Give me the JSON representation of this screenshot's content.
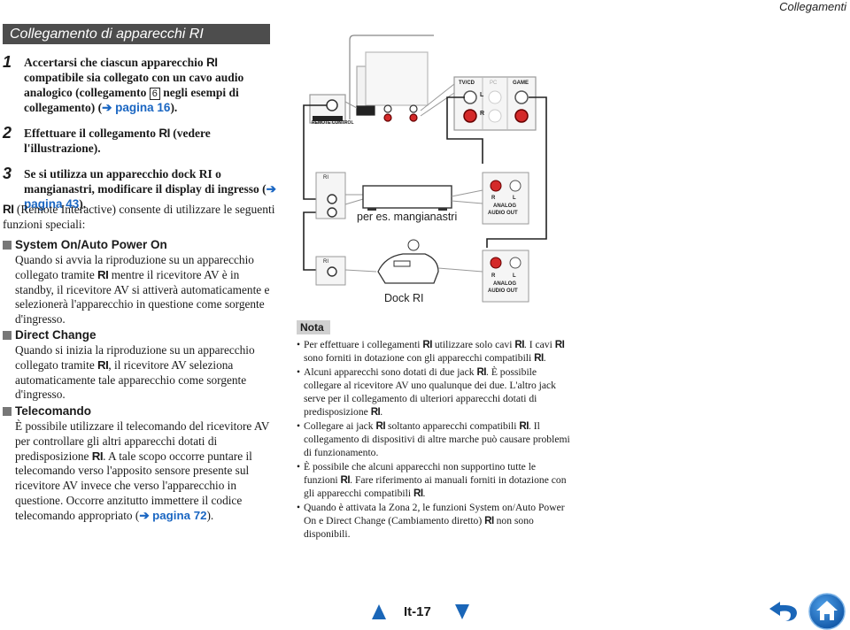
{
  "header": {
    "chapter": "Collegamenti"
  },
  "section": {
    "title": "Collegamento di apparecchi RI"
  },
  "ri_logo": "RI",
  "steps": [
    {
      "num": "1",
      "text_a": "Accertarsi che ciascun apparecchio",
      "text_b": "compatibile sia collegato con un cavo audio analogico (collegamento",
      "box": "6",
      "text_c": "negli esempi di collegamento) (",
      "link": "➔ pagina 16",
      "text_d": ")."
    },
    {
      "num": "2",
      "text_a": "Effettuare il collegamento",
      "text_b": "(vedere l'illustrazione)."
    },
    {
      "num": "3",
      "text_a": "Se si utilizza un apparecchio dock RI o mangianastri, modificare il display di ingresso (",
      "link": "➔ pagina 43",
      "text_d": ")."
    }
  ],
  "intro": {
    "text": "(Remote Interactive) consente di utilizzare le seguenti funzioni speciali:"
  },
  "features": [
    {
      "title": "System On/Auto Power On",
      "body_a": "Quando si avvia la riproduzione su un apparecchio collegato tramite",
      "body_b": "mentre il ricevitore AV è in standby, il ricevitore AV si attiverà automaticamente e selezionerà l'apparecchio in questione come sorgente d'ingresso."
    },
    {
      "title": "Direct Change",
      "body_a": "Quando si inizia la riproduzione su un apparecchio collegato tramite",
      "body_b": ", il ricevitore AV seleziona automaticamente tale apparecchio come sorgente d'ingresso."
    },
    {
      "title": "Telecomando",
      "body_a": "È possibile utilizzare il telecomando del ricevitore AV per controllare gli altri apparecchi dotati di predisposizione",
      "body_b": ". A tale scopo occorre puntare il telecomando verso l'apposito sensore presente sul ricevitore AV invece che verso l'apparecchio in questione. Occorre anzitutto immettere il codice telecomando appropriato (",
      "link": "➔ pagina 72",
      "body_c": ")."
    }
  ],
  "diagram": {
    "remote_control_label": "REMOTE CONTROL",
    "jack_labels": {
      "tvcd": "TV/CD",
      "pc": "PC",
      "game": "GAME",
      "l": "L",
      "r": "R"
    },
    "analog_out": {
      "r": "R",
      "l": "L",
      "line1": "ANALOG",
      "line2": "AUDIO OUT"
    },
    "device1_label": "per es. mangianastri",
    "device2_label": "Dock RI",
    "colors": {
      "red_jack": "#d42a2a",
      "cable": "#222222",
      "panel": "#888888"
    }
  },
  "nota": {
    "label": "Nota",
    "items": [
      {
        "a": "Per effettuare i collegamenti",
        "b": "utilizzare solo cavi",
        "c": ". I cavi",
        "d": "sono forniti in dotazione con gli apparecchi compatibili",
        "e": "."
      },
      {
        "a": "Alcuni apparecchi sono dotati di due jack",
        "b": ". È possibile collegare al ricevitore AV uno qualunque dei due. L'altro jack serve per il collegamento di ulteriori apparecchi dotati di predisposizione",
        "c": "."
      },
      {
        "a": "Collegare ai jack",
        "b": "soltanto apparecchi compatibili",
        "c": ". Il collegamento di dispositivi di altre marche può causare problemi di funzionamento."
      },
      {
        "a": "È possibile che alcuni apparecchi non supportino tutte le funzioni",
        "b": ". Fare riferimento ai manuali forniti in dotazione con gli apparecchi compatibili",
        "c": "."
      },
      {
        "a": "Quando è attivata la Zona 2, le funzioni System on/Auto Power On e Direct Change (Cambiamento diretto)",
        "b": "non sono disponibili."
      }
    ]
  },
  "footer": {
    "page": "It-17",
    "accent": "#1a66b8"
  }
}
